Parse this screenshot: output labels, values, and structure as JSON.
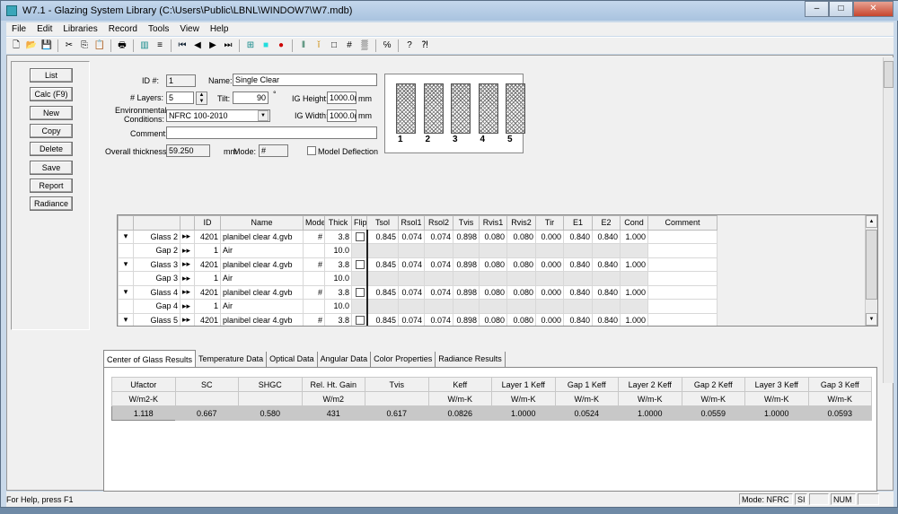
{
  "window": {
    "title": "W7.1 - Glazing System Library (C:\\Users\\Public\\LBNL\\WINDOW7\\W7.mdb)",
    "minimize": "–",
    "maximize": "□",
    "close": "✕"
  },
  "menu": [
    "File",
    "Edit",
    "Libraries",
    "Record",
    "Tools",
    "View",
    "Help"
  ],
  "toolbar": [
    "new-icon",
    "open-icon",
    "save-icon",
    "|",
    "cut-icon",
    "copy-icon",
    "paste-icon",
    "|",
    "print-icon",
    "|",
    "list-view-icon",
    "detail-view-icon",
    "|",
    "first-record-icon",
    "previous-record-icon",
    "next-record-icon",
    "last-record-icon",
    "|",
    "grid-icon",
    "cyan-square-icon",
    "red-marker-icon",
    "|",
    "layers-icon",
    "light-icon",
    "frame-icon",
    "hash-icon",
    "hatch-icon",
    "|",
    "units-icon",
    "|",
    "help-icon",
    "context-help-icon"
  ],
  "toolbar_glyphs": {
    "new-icon": "🗋",
    "open-icon": "📂",
    "save-icon": "💾",
    "cut-icon": "✂",
    "copy-icon": "⎘",
    "paste-icon": "📋",
    "print-icon": "🖶",
    "list-view-icon": "▥",
    "detail-view-icon": "≡",
    "first-record-icon": "⏮",
    "previous-record-icon": "◀",
    "next-record-icon": "▶",
    "last-record-icon": "⏭",
    "grid-icon": "⊞",
    "cyan-square-icon": "■",
    "red-marker-icon": "●",
    "layers-icon": "‖",
    "light-icon": "ǐ",
    "frame-icon": "□",
    "hash-icon": "#",
    "hatch-icon": "▒",
    "units-icon": "℅",
    "help-icon": "?",
    "context-help-icon": "⁈"
  },
  "sidebar": {
    "buttons": [
      "List",
      "Calc (F9)",
      "New",
      "Copy",
      "Delete",
      "Save",
      "Report",
      "Radiance"
    ]
  },
  "form": {
    "id_label": "ID #:",
    "id_value": "1",
    "name_label": "Name:",
    "name_value": "Single Clear",
    "layers_label": "# Layers:",
    "layers_value": "5",
    "tilt_label": "Tilt:",
    "tilt_value": "90",
    "tilt_unit": "°",
    "ig_height_label": "IG Height:",
    "ig_height_value": "1000.0(",
    "ig_height_unit": "mm",
    "env_label": "Environmental Conditions:",
    "env_value": "NFRC 100-2010",
    "ig_width_label": "IG Width:",
    "ig_width_value": "1000.0(",
    "ig_width_unit": "mm",
    "comment_label": "Comment:",
    "comment_value": "",
    "thickness_label": "Overall thickness:",
    "thickness_value": "59.250",
    "thickness_unit": "mm",
    "mode_label": "Mode:",
    "mode_value": "#",
    "deflection_label": "Model Deflection",
    "deflection_checked": false
  },
  "preview": {
    "layers": [
      "1",
      "2",
      "3",
      "4",
      "5"
    ]
  },
  "layers_grid": {
    "columns": [
      "",
      "",
      "",
      "ID",
      "Name",
      "Mode",
      "Thick",
      "Flip",
      "Tsol",
      "Rsol1",
      "Rsol2",
      "Tvis",
      "Rvis1",
      "Rvis2",
      "Tir",
      "E1",
      "E2",
      "Cond",
      "Comment"
    ],
    "rows": [
      {
        "type": "glass",
        "label": "Glass 2",
        "id": "4201",
        "name": "planibel clear 4.gvb",
        "mode": "#",
        "thick": "3.8",
        "values": [
          "0.845",
          "0.074",
          "0.074",
          "0.898",
          "0.080",
          "0.080",
          "0.000",
          "0.840",
          "0.840",
          "1.000"
        ]
      },
      {
        "type": "gap",
        "label": "Gap 2",
        "id": "1",
        "name": "Air",
        "mode": "",
        "thick": "10.0",
        "values": []
      },
      {
        "type": "glass",
        "label": "Glass 3",
        "id": "4201",
        "name": "planibel clear 4.gvb",
        "mode": "#",
        "thick": "3.8",
        "values": [
          "0.845",
          "0.074",
          "0.074",
          "0.898",
          "0.080",
          "0.080",
          "0.000",
          "0.840",
          "0.840",
          "1.000"
        ]
      },
      {
        "type": "gap",
        "label": "Gap 3",
        "id": "1",
        "name": "Air",
        "mode": "",
        "thick": "10.0",
        "values": []
      },
      {
        "type": "glass",
        "label": "Glass 4",
        "id": "4201",
        "name": "planibel clear 4.gvb",
        "mode": "#",
        "thick": "3.8",
        "values": [
          "0.845",
          "0.074",
          "0.074",
          "0.898",
          "0.080",
          "0.080",
          "0.000",
          "0.840",
          "0.840",
          "1.000"
        ]
      },
      {
        "type": "gap",
        "label": "Gap 4",
        "id": "1",
        "name": "Air",
        "mode": "",
        "thick": "10.0",
        "values": []
      },
      {
        "type": "glass",
        "label": "Glass 5",
        "id": "4201",
        "name": "planibel clear 4.gvb",
        "mode": "#",
        "thick": "3.8",
        "values": [
          "0.845",
          "0.074",
          "0.074",
          "0.898",
          "0.080",
          "0.080",
          "0.000",
          "0.840",
          "0.840",
          "1.000"
        ]
      }
    ]
  },
  "tabs": [
    {
      "label": "Center of Glass Results",
      "active": true
    },
    {
      "label": "Temperature Data"
    },
    {
      "label": "Optical Data"
    },
    {
      "label": "Angular Data"
    },
    {
      "label": "Color Properties"
    },
    {
      "label": "Radiance Results"
    }
  ],
  "results": {
    "headers": [
      "Ufactor",
      "SC",
      "SHGC",
      "Rel. Ht. Gain",
      "Tvis",
      "Keff",
      "Layer 1 Keff",
      "Gap 1 Keff",
      "Layer 2 Keff",
      "Gap 2 Keff",
      "Layer 3 Keff",
      "Gap 3 Keff"
    ],
    "units": [
      "W/m2-K",
      "",
      "",
      "W/m2",
      "",
      "W/m-K",
      "W/m-K",
      "W/m-K",
      "W/m-K",
      "W/m-K",
      "W/m-K",
      "W/m-K"
    ],
    "values": [
      "1.118",
      "0.667",
      "0.580",
      "431",
      "0.617",
      "0.0826",
      "1.0000",
      "0.0524",
      "1.0000",
      "0.0559",
      "1.0000",
      "0.0593"
    ]
  },
  "status": {
    "help": "For Help, press F1",
    "mode": "Mode: NFRC",
    "units": "SI",
    "num": "NUM"
  }
}
